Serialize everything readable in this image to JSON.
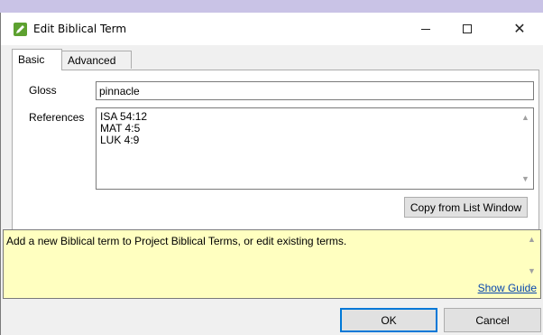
{
  "window": {
    "title": "Edit Biblical Term",
    "icon": "pencil-edit-icon",
    "controls": {
      "minimize": "minimize-icon",
      "maximize": "maximize-icon",
      "close": "close-icon"
    },
    "accent_color": "#0078d7"
  },
  "tabs": [
    {
      "label": "Basic",
      "active": true
    },
    {
      "label": "Advanced",
      "active": false
    }
  ],
  "form": {
    "gloss_label": "Gloss",
    "gloss_value": "pinnacle",
    "references_label": "References",
    "references": [
      "ISA 54:12",
      "MAT 4:5",
      "LUK 4:9"
    ],
    "copy_button": "Copy from List Window"
  },
  "help": {
    "text": "Add a new Biblical term to Project Biblical Terms, or edit existing terms.",
    "link": "Show Guide",
    "background": "#ffffc0"
  },
  "buttons": {
    "ok": "OK",
    "cancel": "Cancel"
  }
}
